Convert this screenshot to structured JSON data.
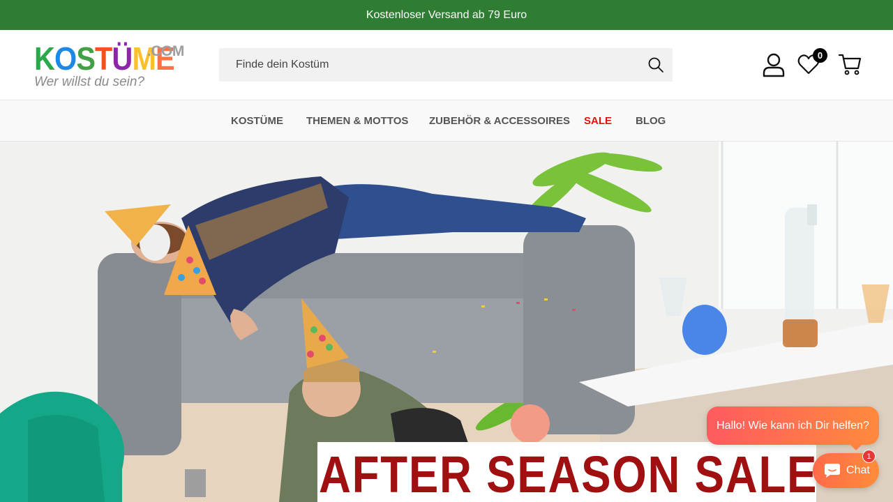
{
  "announcement": {
    "text": "Kostenloser Versand ab 79 Euro"
  },
  "logo": {
    "letters": [
      "K",
      "O",
      "S",
      "T",
      "Ü",
      "M",
      "E"
    ],
    "letter_colors": [
      "#2aa84a",
      "#1e88e5",
      "#2aa84a",
      "#f4511e",
      "#8e24aa",
      "#fbc02d",
      "#ff7043"
    ],
    "domain_suffix": ".COM",
    "tagline": "Wer willst du sein?"
  },
  "search": {
    "placeholder": "Finde dein Kostüm",
    "value": ""
  },
  "header_icons": {
    "account": "user-icon",
    "wishlist": "heart-icon",
    "wishlist_count": "0",
    "cart": "cart-icon"
  },
  "nav": {
    "items": [
      {
        "label": "KOSTÜME"
      },
      {
        "label": "THEMEN & MOTTOS"
      },
      {
        "label": "ZUBEHÖR & ACCESSOIRES"
      },
      {
        "label": "SALE"
      },
      {
        "label": "BLOG"
      }
    ]
  },
  "hero": {
    "banner_text": "AFTER SEASON SALE",
    "banner_color": "#a01010"
  },
  "chat": {
    "greeting": "Hallo! Wie kann ich Dir helfen?",
    "button_label": "Chat",
    "unread_count": "1"
  },
  "colors": {
    "announcement_bg": "#2e7d32",
    "sale_red": "#e01010",
    "chat_gradient_start": "#ff5a5f",
    "chat_gradient_end": "#ff8a3d"
  }
}
